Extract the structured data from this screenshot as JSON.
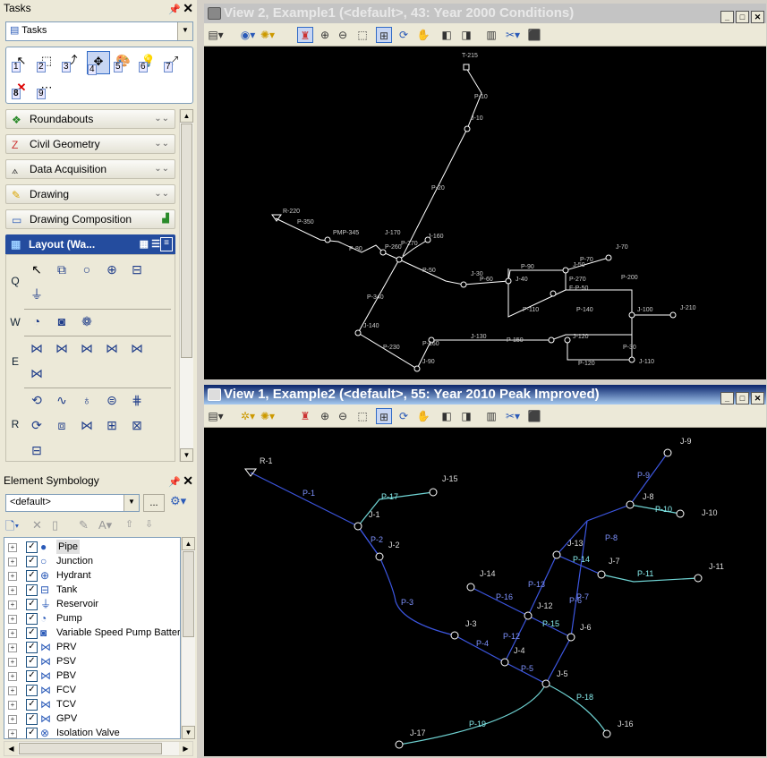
{
  "tasks_panel": {
    "title": "Tasks",
    "combo_value": "Tasks",
    "tool_numbers": [
      "1",
      "2",
      "3",
      "4",
      "5",
      "6",
      "7",
      "8",
      "9"
    ],
    "categories": [
      {
        "label": "Roundabouts",
        "icon": "roundabout-icon"
      },
      {
        "label": "Civil Geometry",
        "icon": "civil-geometry-icon"
      },
      {
        "label": "Data Acquisition",
        "icon": "data-acquisition-icon"
      },
      {
        "label": "Drawing",
        "icon": "drawing-icon"
      },
      {
        "label": "Drawing Composition",
        "icon": "drawing-composition-icon"
      }
    ],
    "layout_header": "Layout (Wa...",
    "palette_rows": [
      "Q",
      "W",
      "E",
      "R"
    ]
  },
  "symbology_panel": {
    "title": "Element Symbology",
    "combo_value": "<default>",
    "more_button": "...",
    "items": [
      {
        "label": "Pipe",
        "icon": "pipe-icon",
        "selected": true
      },
      {
        "label": "Junction",
        "icon": "junction-icon"
      },
      {
        "label": "Hydrant",
        "icon": "hydrant-icon"
      },
      {
        "label": "Tank",
        "icon": "tank-icon"
      },
      {
        "label": "Reservoir",
        "icon": "reservoir-icon"
      },
      {
        "label": "Pump",
        "icon": "pump-icon"
      },
      {
        "label": "Variable Speed Pump Battery",
        "icon": "vsp-battery-icon"
      },
      {
        "label": "PRV",
        "icon": "prv-icon"
      },
      {
        "label": "PSV",
        "icon": "psv-icon"
      },
      {
        "label": "PBV",
        "icon": "pbv-icon"
      },
      {
        "label": "FCV",
        "icon": "fcv-icon"
      },
      {
        "label": "TCV",
        "icon": "tcv-icon"
      },
      {
        "label": "GPV",
        "icon": "gpv-icon"
      },
      {
        "label": "Isolation Valve",
        "icon": "isolation-valve-icon"
      }
    ]
  },
  "view2": {
    "title": "View 2, Example1 (<default>, 43: Year 2000 Conditions)",
    "labels": [
      "T-215",
      "P-10",
      "J-10",
      "P-20",
      "R-220",
      "P-350",
      "PMP-345",
      "P-80",
      "J-170",
      "P-260",
      "P-270",
      "J-160",
      "P-340",
      "P-50",
      "J-30",
      "P-60",
      "P-90",
      "J-40",
      "J-50",
      "P-110",
      "P-70",
      "J-70",
      "P-270",
      "F-P-50",
      "P-200",
      "P-140",
      "J-100",
      "J-210",
      "J-140",
      "P-230",
      "P-160",
      "J-130",
      "P-150",
      "J-120",
      "P-30",
      "P-120",
      "J-110",
      "J-90"
    ]
  },
  "view1": {
    "title": "View 1, Example2 (<default>, 55: Year 2010 Peak Improved)",
    "labels": [
      "R-1",
      "P-1",
      "J-15",
      "P-17",
      "J-1",
      "P-2",
      "J-2",
      "P-3",
      "J-3",
      "P-4",
      "J-4",
      "P-12",
      "P-5",
      "J-5",
      "P-18",
      "J-16",
      "P-19",
      "J-17",
      "J-14",
      "P-16",
      "J-12",
      "P-15",
      "J-6",
      "P-13",
      "J-13",
      "P-14",
      "J-7",
      "P-6",
      "P-7",
      "P-8",
      "J-8",
      "P-9",
      "J-9",
      "P-10",
      "J-10",
      "P-11",
      "J-11"
    ]
  },
  "colors": {
    "view_bg": "#000000",
    "pipe_blue": "#3c56e0",
    "pipe_cyan": "#6fd3d3",
    "active_title": "#0a246a"
  }
}
